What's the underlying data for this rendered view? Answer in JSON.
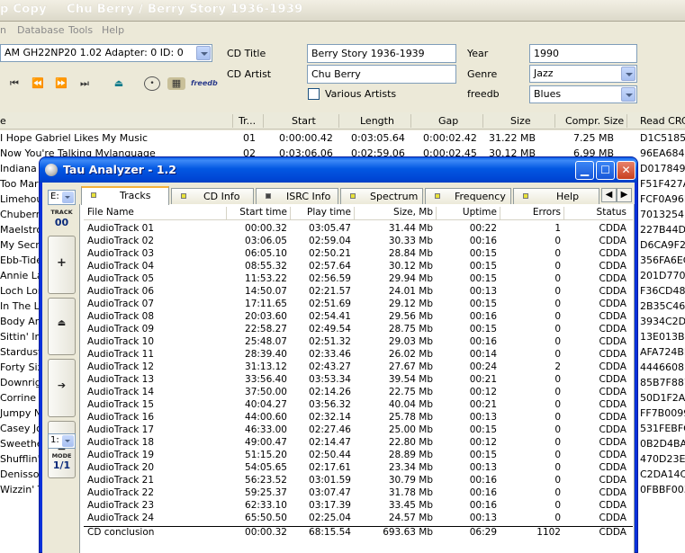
{
  "bg": {
    "title_left": "p Copy",
    "title_right": "Chu Berry / Berry Story 1936-1939",
    "menu": [
      "n",
      "Database",
      "Tools",
      "Help"
    ],
    "drive": "AM GH22NP20 1.02  Adapter: 0  ID: 0",
    "cd_title_label": "CD Title",
    "cd_title": "Berry Story 1936-1939",
    "cd_artist_label": "CD Artist",
    "cd_artist": "Chu Berry",
    "various_label": "Various Artists",
    "year_label": "Year",
    "year": "1990",
    "genre_label": "Genre",
    "genre": "Jazz",
    "freedb_label": "freedb",
    "freedb_genre": "Blues",
    "freedb_logo": "freedb",
    "columns": [
      "e",
      "Tr...",
      "Start",
      "Length",
      "Gap",
      "Size",
      "Compr. Size",
      "Read CRC"
    ],
    "rows": [
      {
        "title": "I Hope Gabriel Likes My Music",
        "tr": "01",
        "start": "0:00:00.42",
        "length": "0:03:05.64",
        "gap": "0:00:02.42",
        "size": "31.22 MB",
        "compr": "7.25 MB",
        "crc": "D1C51857"
      },
      {
        "title": "Now You're Talking Mylanguage",
        "tr": "02",
        "start": "0:03:06.06",
        "length": "0:02:59.06",
        "gap": "0:00:02.45",
        "size": "30.12 MB",
        "compr": "6.99 MB",
        "crc": "96EA684B"
      },
      {
        "title": "Indiana",
        "crc": "D0178494"
      },
      {
        "title": "Too Marv",
        "crc": "F51F427A"
      },
      {
        "title": "Limehous",
        "crc": "FCF0A96F"
      },
      {
        "title": "Chuberry",
        "crc": "70132541"
      },
      {
        "title": "Maelstron",
        "crc": "227B44D4"
      },
      {
        "title": "My Secre",
        "crc": "D6CA9F22"
      },
      {
        "title": "Ebb-Tide",
        "crc": "356FA6EC"
      },
      {
        "title": "Annie Lau",
        "crc": "201D770E"
      },
      {
        "title": "Loch Lom",
        "crc": "F36CD484"
      },
      {
        "title": "In The La",
        "crc": "2B35C46F"
      },
      {
        "title": "Body And",
        "crc": "3934C2D2"
      },
      {
        "title": "Sittin' In",
        "crc": "13E013B2"
      },
      {
        "title": "Stardust",
        "crc": "AFA724BE"
      },
      {
        "title": "Forty Six",
        "crc": "4446608B"
      },
      {
        "title": "Downrigh",
        "crc": "85B7F887"
      },
      {
        "title": "Corrine C",
        "crc": "50D1F2AD"
      },
      {
        "title": "Jumpy Ne",
        "crc": "FF7B0099"
      },
      {
        "title": "Casey Jo",
        "crc": "531FEBFC"
      },
      {
        "title": "Sweethea",
        "crc": "0B2D4BA4"
      },
      {
        "title": "Shufflin' A",
        "crc": "470D23EB"
      },
      {
        "title": "Denisson",
        "crc": "C2DA14C8"
      },
      {
        "title": "Wizzin' Th",
        "crc": "0FBBF003"
      }
    ]
  },
  "tau": {
    "title": "Tau Analyzer - 1.2",
    "drive_letter": "E:",
    "track_caption": "TRACK",
    "track_value": "00",
    "mode_select": "1:",
    "mode_caption": "MODE",
    "mode_value": "1/1",
    "tabs": [
      "Tracks",
      "CD Info",
      "ISRC Info",
      "Spectrum",
      "Frequency",
      "Help"
    ],
    "columns": [
      "File Name",
      "Start time",
      "Play time",
      "Size, Mb",
      "Uptime",
      "Errors",
      "Status"
    ],
    "rows": [
      [
        "AudioTrack 01",
        "00:00.32",
        "03:05.47",
        "31.44 Mb",
        "00:22",
        "1",
        "CDDA"
      ],
      [
        "AudioTrack 02",
        "03:06.05",
        "02:59.04",
        "30.33 Mb",
        "00:16",
        "0",
        "CDDA"
      ],
      [
        "AudioTrack 03",
        "06:05.10",
        "02:50.21",
        "28.84 Mb",
        "00:15",
        "0",
        "CDDA"
      ],
      [
        "AudioTrack 04",
        "08:55.32",
        "02:57.64",
        "30.12 Mb",
        "00:15",
        "0",
        "CDDA"
      ],
      [
        "AudioTrack 05",
        "11:53.22",
        "02:56.59",
        "29.94 Mb",
        "00:15",
        "0",
        "CDDA"
      ],
      [
        "AudioTrack 06",
        "14:50.07",
        "02:21.57",
        "24.01 Mb",
        "00:13",
        "0",
        "CDDA"
      ],
      [
        "AudioTrack 07",
        "17:11.65",
        "02:51.69",
        "29.12 Mb",
        "00:15",
        "0",
        "CDDA"
      ],
      [
        "AudioTrack 08",
        "20:03.60",
        "02:54.41",
        "29.56 Mb",
        "00:16",
        "0",
        "CDDA"
      ],
      [
        "AudioTrack 09",
        "22:58.27",
        "02:49.54",
        "28.75 Mb",
        "00:15",
        "0",
        "CDDA"
      ],
      [
        "AudioTrack 10",
        "25:48.07",
        "02:51.32",
        "29.03 Mb",
        "00:16",
        "0",
        "CDDA"
      ],
      [
        "AudioTrack 11",
        "28:39.40",
        "02:33.46",
        "26.02 Mb",
        "00:14",
        "0",
        "CDDA"
      ],
      [
        "AudioTrack 12",
        "31:13.12",
        "02:43.27",
        "27.67 Mb",
        "00:24",
        "2",
        "CDDA"
      ],
      [
        "AudioTrack 13",
        "33:56.40",
        "03:53.34",
        "39.54 Mb",
        "00:21",
        "0",
        "CDDA"
      ],
      [
        "AudioTrack 14",
        "37:50.00",
        "02:14.26",
        "22.75 Mb",
        "00:12",
        "0",
        "CDDA"
      ],
      [
        "AudioTrack 15",
        "40:04.27",
        "03:56.32",
        "40.04 Mb",
        "00:21",
        "0",
        "CDDA"
      ],
      [
        "AudioTrack 16",
        "44:00.60",
        "02:32.14",
        "25.78 Mb",
        "00:13",
        "0",
        "CDDA"
      ],
      [
        "AudioTrack 17",
        "46:33.00",
        "02:27.46",
        "25.00 Mb",
        "00:15",
        "0",
        "CDDA"
      ],
      [
        "AudioTrack 18",
        "49:00.47",
        "02:14.47",
        "22.80 Mb",
        "00:12",
        "0",
        "CDDA"
      ],
      [
        "AudioTrack 19",
        "51:15.20",
        "02:50.44",
        "28.89 Mb",
        "00:15",
        "0",
        "CDDA"
      ],
      [
        "AudioTrack 20",
        "54:05.65",
        "02:17.61",
        "23.34 Mb",
        "00:13",
        "0",
        "CDDA"
      ],
      [
        "AudioTrack 21",
        "56:23.52",
        "03:01.59",
        "30.79 Mb",
        "00:16",
        "0",
        "CDDA"
      ],
      [
        "AudioTrack 22",
        "59:25.37",
        "03:07.47",
        "31.78 Mb",
        "00:16",
        "0",
        "CDDA"
      ],
      [
        "AudioTrack 23",
        "62:33.10",
        "03:17.39",
        "33.45 Mb",
        "00:16",
        "0",
        "CDDA"
      ],
      [
        "AudioTrack 24",
        "65:50.50",
        "02:25.04",
        "24.57 Mb",
        "00:13",
        "0",
        "CDDA"
      ]
    ],
    "conclusion": [
      "CD conclusion",
      "00:00.32",
      "68:15.54",
      "693.63 Mb",
      "06:29",
      "1102",
      "CDDA"
    ]
  }
}
